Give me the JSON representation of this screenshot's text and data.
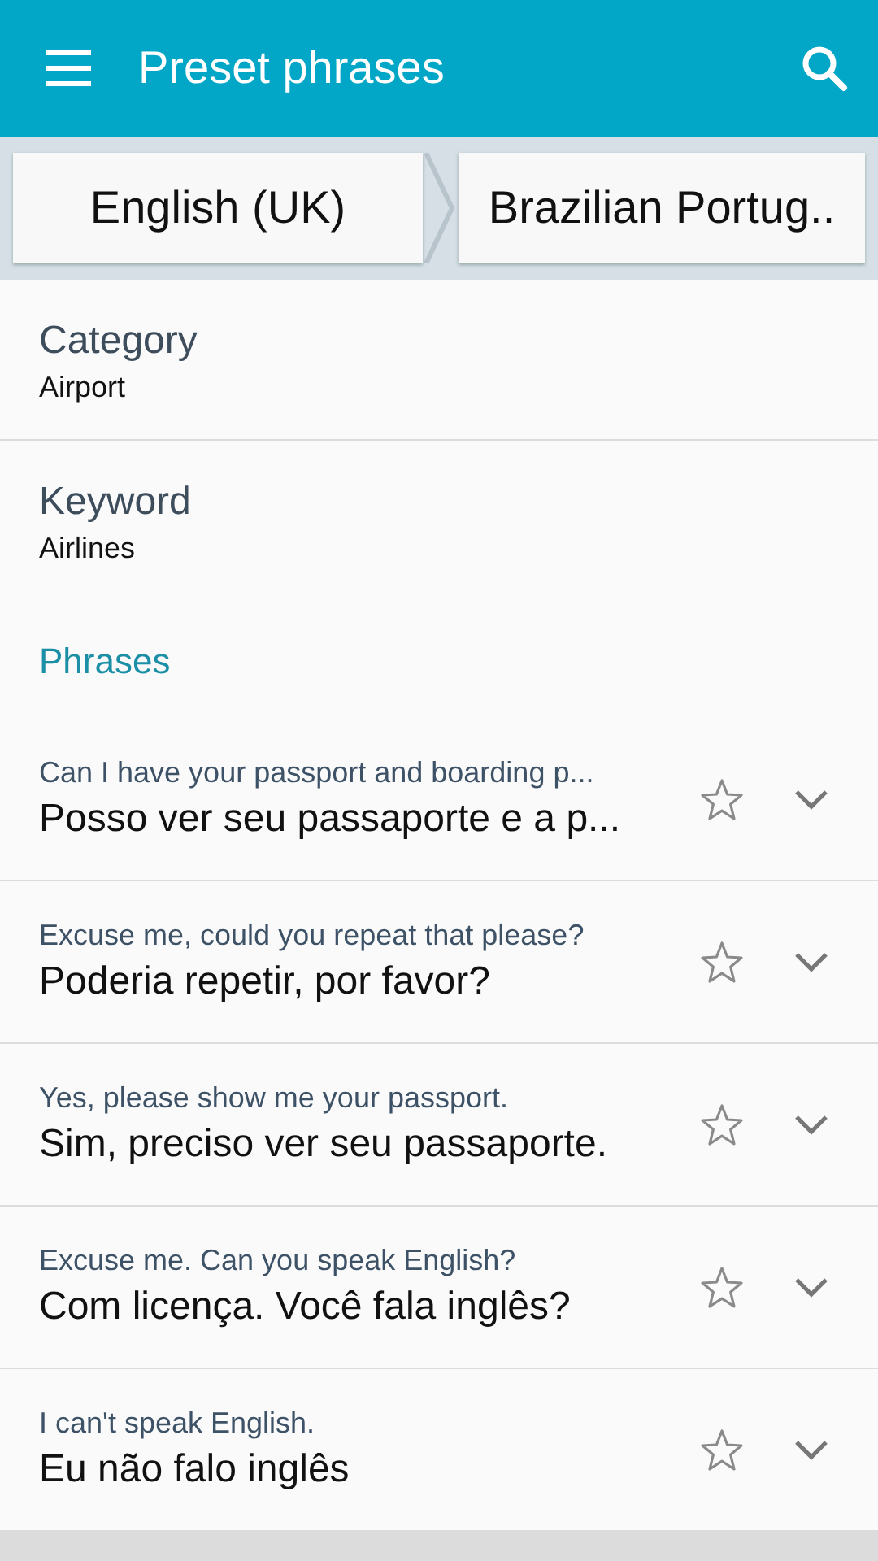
{
  "app_bar": {
    "title": "Preset phrases"
  },
  "languages": {
    "source": "English (UK)",
    "target": "Brazilian Portug.."
  },
  "filters": [
    {
      "label": "Category",
      "value": "Airport"
    },
    {
      "label": "Keyword",
      "value": "Airlines"
    }
  ],
  "section_title": "Phrases",
  "phrases": [
    {
      "source": "Can I have your passport and boarding p...",
      "translation": "Posso ver seu passaporte e a p...",
      "starred": false,
      "expanded": false
    },
    {
      "source": "Excuse me, could you repeat that please?",
      "translation": "Poderia repetir, por favor?",
      "starred": false,
      "expanded": false
    },
    {
      "source": "Yes, please show me your passport.",
      "translation": "Sim, preciso ver seu passaporte.",
      "starred": false,
      "expanded": false
    },
    {
      "source": "Excuse me. Can you speak English?",
      "translation": "Com licença. Você fala inglês?",
      "starred": false,
      "expanded": false
    },
    {
      "source": "I can't speak English.",
      "translation": "Eu não falo inglês",
      "starred": false,
      "expanded": false
    }
  ]
}
